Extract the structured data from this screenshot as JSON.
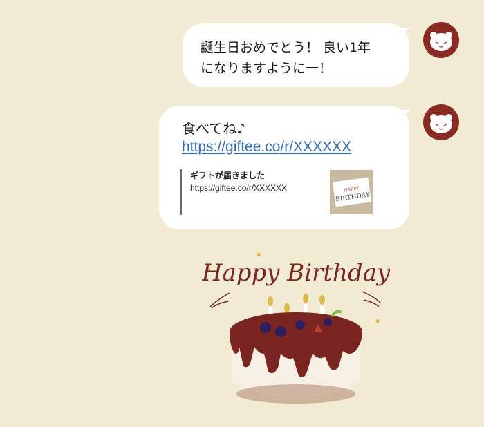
{
  "messages": [
    {
      "text": "誕生日おめでとう！ 良い1年\nになりますように一！",
      "avatar": "cat-avatar-icon"
    },
    {
      "text": "食べてね♪",
      "link": "https://giftee.co/r/XXXXXX",
      "avatar": "cat-avatar-icon",
      "preview": {
        "title": "ギフトが届きました",
        "url": "https://giftee.co/r/XXXXXX",
        "thumbnail_text": "HAPPY BIRTHDAY"
      }
    }
  ],
  "sticker": {
    "text": "Happy Birthday",
    "icon": "birthday-cake-icon"
  },
  "colors": {
    "background": "#f2ebd4",
    "bubble": "#ffffff",
    "avatar": "#8a2a22",
    "link": "#2f6bc6",
    "chocolate": "#7a2520"
  }
}
